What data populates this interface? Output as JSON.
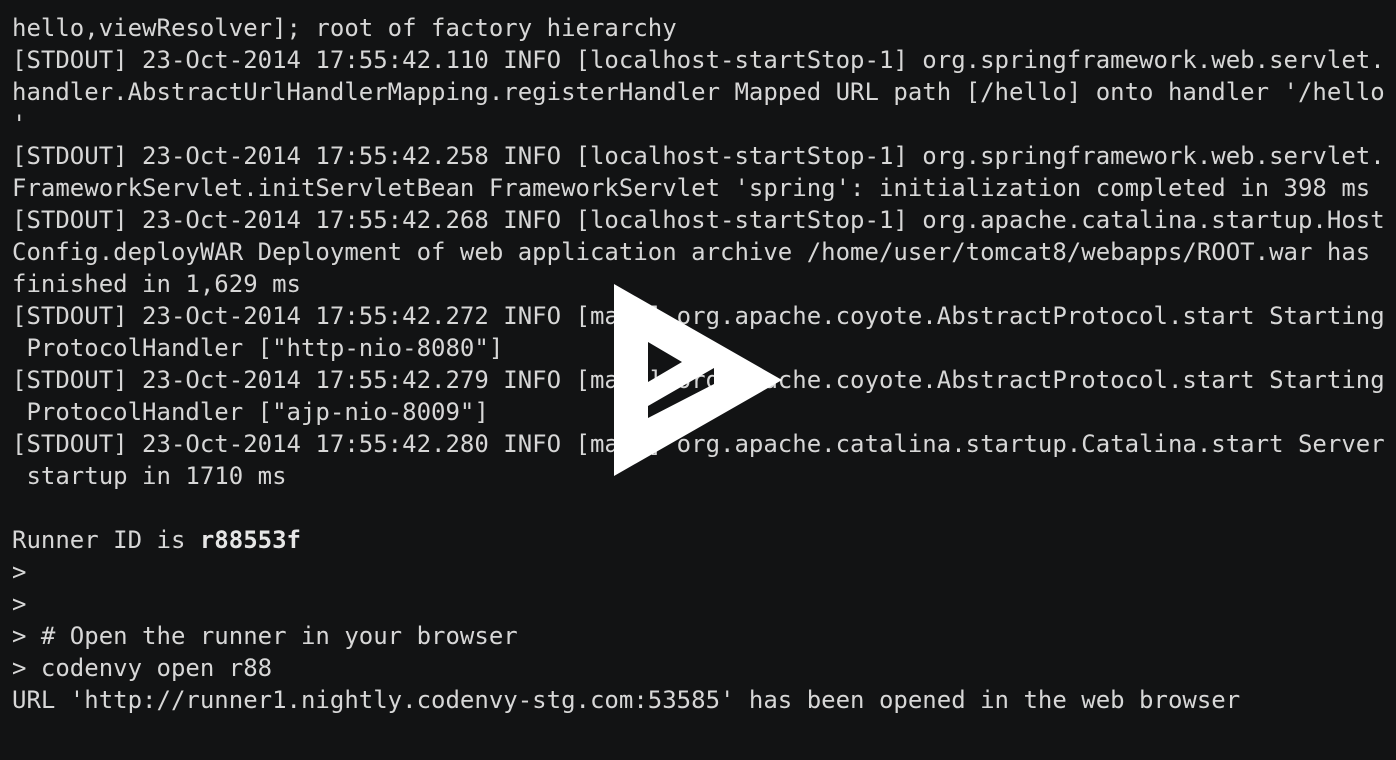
{
  "terminal": {
    "lines": [
      "hello,viewResolver]; root of factory hierarchy",
      "[STDOUT] 23-Oct-2014 17:55:42.110 INFO [localhost-startStop-1] org.springframework.web.servlet.",
      "handler.AbstractUrlHandlerMapping.registerHandler Mapped URL path [/hello] onto handler '/hello",
      "'",
      "[STDOUT] 23-Oct-2014 17:55:42.258 INFO [localhost-startStop-1] org.springframework.web.servlet.",
      "FrameworkServlet.initServletBean FrameworkServlet 'spring': initialization completed in 398 ms",
      "[STDOUT] 23-Oct-2014 17:55:42.268 INFO [localhost-startStop-1] org.apache.catalina.startup.Host",
      "Config.deployWAR Deployment of web application archive /home/user/tomcat8/webapps/ROOT.war has",
      "finished in 1,629 ms",
      "[STDOUT] 23-Oct-2014 17:55:42.272 INFO [main] org.apache.coyote.AbstractProtocol.start Starting",
      " ProtocolHandler [\"http-nio-8080\"]",
      "[STDOUT] 23-Oct-2014 17:55:42.279 INFO [main] org.apache.coyote.AbstractProtocol.start Starting",
      " ProtocolHandler [\"ajp-nio-8009\"]",
      "[STDOUT] 23-Oct-2014 17:55:42.280 INFO [main] org.apache.catalina.startup.Catalina.start Server",
      " startup in 1710 ms",
      ""
    ],
    "runner_prefix": "Runner ID is ",
    "runner_id": "r88553f",
    "prompt_lines": [
      ">",
      ">",
      "> # Open the runner in your browser",
      "> codenvy open r88",
      "URL 'http://runner1.nightly.codenvy-stg.com:53585' has been opened in the web browser"
    ]
  },
  "overlay": {
    "icon": "play-icon",
    "color": "#ffffff"
  },
  "colors": {
    "background": "#121314",
    "text": "#d7d7d7"
  }
}
